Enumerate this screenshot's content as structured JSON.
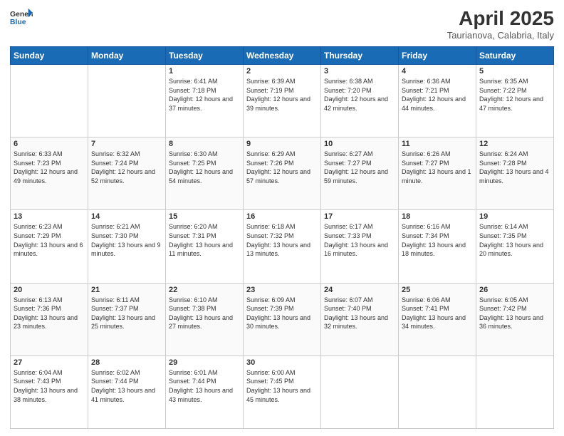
{
  "logo": {
    "line1": "General",
    "line2": "Blue"
  },
  "title": "April 2025",
  "subtitle": "Taurianova, Calabria, Italy",
  "days_of_week": [
    "Sunday",
    "Monday",
    "Tuesday",
    "Wednesday",
    "Thursday",
    "Friday",
    "Saturday"
  ],
  "weeks": [
    [
      {
        "day": "",
        "sunrise": "",
        "sunset": "",
        "daylight": ""
      },
      {
        "day": "",
        "sunrise": "",
        "sunset": "",
        "daylight": ""
      },
      {
        "day": "1",
        "sunrise": "Sunrise: 6:41 AM",
        "sunset": "Sunset: 7:18 PM",
        "daylight": "Daylight: 12 hours and 37 minutes."
      },
      {
        "day": "2",
        "sunrise": "Sunrise: 6:39 AM",
        "sunset": "Sunset: 7:19 PM",
        "daylight": "Daylight: 12 hours and 39 minutes."
      },
      {
        "day": "3",
        "sunrise": "Sunrise: 6:38 AM",
        "sunset": "Sunset: 7:20 PM",
        "daylight": "Daylight: 12 hours and 42 minutes."
      },
      {
        "day": "4",
        "sunrise": "Sunrise: 6:36 AM",
        "sunset": "Sunset: 7:21 PM",
        "daylight": "Daylight: 12 hours and 44 minutes."
      },
      {
        "day": "5",
        "sunrise": "Sunrise: 6:35 AM",
        "sunset": "Sunset: 7:22 PM",
        "daylight": "Daylight: 12 hours and 47 minutes."
      }
    ],
    [
      {
        "day": "6",
        "sunrise": "Sunrise: 6:33 AM",
        "sunset": "Sunset: 7:23 PM",
        "daylight": "Daylight: 12 hours and 49 minutes."
      },
      {
        "day": "7",
        "sunrise": "Sunrise: 6:32 AM",
        "sunset": "Sunset: 7:24 PM",
        "daylight": "Daylight: 12 hours and 52 minutes."
      },
      {
        "day": "8",
        "sunrise": "Sunrise: 6:30 AM",
        "sunset": "Sunset: 7:25 PM",
        "daylight": "Daylight: 12 hours and 54 minutes."
      },
      {
        "day": "9",
        "sunrise": "Sunrise: 6:29 AM",
        "sunset": "Sunset: 7:26 PM",
        "daylight": "Daylight: 12 hours and 57 minutes."
      },
      {
        "day": "10",
        "sunrise": "Sunrise: 6:27 AM",
        "sunset": "Sunset: 7:27 PM",
        "daylight": "Daylight: 12 hours and 59 minutes."
      },
      {
        "day": "11",
        "sunrise": "Sunrise: 6:26 AM",
        "sunset": "Sunset: 7:27 PM",
        "daylight": "Daylight: 13 hours and 1 minute."
      },
      {
        "day": "12",
        "sunrise": "Sunrise: 6:24 AM",
        "sunset": "Sunset: 7:28 PM",
        "daylight": "Daylight: 13 hours and 4 minutes."
      }
    ],
    [
      {
        "day": "13",
        "sunrise": "Sunrise: 6:23 AM",
        "sunset": "Sunset: 7:29 PM",
        "daylight": "Daylight: 13 hours and 6 minutes."
      },
      {
        "day": "14",
        "sunrise": "Sunrise: 6:21 AM",
        "sunset": "Sunset: 7:30 PM",
        "daylight": "Daylight: 13 hours and 9 minutes."
      },
      {
        "day": "15",
        "sunrise": "Sunrise: 6:20 AM",
        "sunset": "Sunset: 7:31 PM",
        "daylight": "Daylight: 13 hours and 11 minutes."
      },
      {
        "day": "16",
        "sunrise": "Sunrise: 6:18 AM",
        "sunset": "Sunset: 7:32 PM",
        "daylight": "Daylight: 13 hours and 13 minutes."
      },
      {
        "day": "17",
        "sunrise": "Sunrise: 6:17 AM",
        "sunset": "Sunset: 7:33 PM",
        "daylight": "Daylight: 13 hours and 16 minutes."
      },
      {
        "day": "18",
        "sunrise": "Sunrise: 6:16 AM",
        "sunset": "Sunset: 7:34 PM",
        "daylight": "Daylight: 13 hours and 18 minutes."
      },
      {
        "day": "19",
        "sunrise": "Sunrise: 6:14 AM",
        "sunset": "Sunset: 7:35 PM",
        "daylight": "Daylight: 13 hours and 20 minutes."
      }
    ],
    [
      {
        "day": "20",
        "sunrise": "Sunrise: 6:13 AM",
        "sunset": "Sunset: 7:36 PM",
        "daylight": "Daylight: 13 hours and 23 minutes."
      },
      {
        "day": "21",
        "sunrise": "Sunrise: 6:11 AM",
        "sunset": "Sunset: 7:37 PM",
        "daylight": "Daylight: 13 hours and 25 minutes."
      },
      {
        "day": "22",
        "sunrise": "Sunrise: 6:10 AM",
        "sunset": "Sunset: 7:38 PM",
        "daylight": "Daylight: 13 hours and 27 minutes."
      },
      {
        "day": "23",
        "sunrise": "Sunrise: 6:09 AM",
        "sunset": "Sunset: 7:39 PM",
        "daylight": "Daylight: 13 hours and 30 minutes."
      },
      {
        "day": "24",
        "sunrise": "Sunrise: 6:07 AM",
        "sunset": "Sunset: 7:40 PM",
        "daylight": "Daylight: 13 hours and 32 minutes."
      },
      {
        "day": "25",
        "sunrise": "Sunrise: 6:06 AM",
        "sunset": "Sunset: 7:41 PM",
        "daylight": "Daylight: 13 hours and 34 minutes."
      },
      {
        "day": "26",
        "sunrise": "Sunrise: 6:05 AM",
        "sunset": "Sunset: 7:42 PM",
        "daylight": "Daylight: 13 hours and 36 minutes."
      }
    ],
    [
      {
        "day": "27",
        "sunrise": "Sunrise: 6:04 AM",
        "sunset": "Sunset: 7:43 PM",
        "daylight": "Daylight: 13 hours and 38 minutes."
      },
      {
        "day": "28",
        "sunrise": "Sunrise: 6:02 AM",
        "sunset": "Sunset: 7:44 PM",
        "daylight": "Daylight: 13 hours and 41 minutes."
      },
      {
        "day": "29",
        "sunrise": "Sunrise: 6:01 AM",
        "sunset": "Sunset: 7:44 PM",
        "daylight": "Daylight: 13 hours and 43 minutes."
      },
      {
        "day": "30",
        "sunrise": "Sunrise: 6:00 AM",
        "sunset": "Sunset: 7:45 PM",
        "daylight": "Daylight: 13 hours and 45 minutes."
      },
      {
        "day": "",
        "sunrise": "",
        "sunset": "",
        "daylight": ""
      },
      {
        "day": "",
        "sunrise": "",
        "sunset": "",
        "daylight": ""
      },
      {
        "day": "",
        "sunrise": "",
        "sunset": "",
        "daylight": ""
      }
    ]
  ]
}
